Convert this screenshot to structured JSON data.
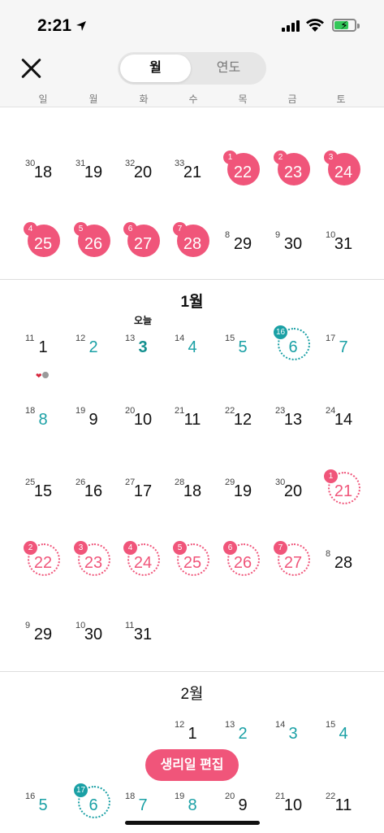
{
  "status": {
    "time": "2:21"
  },
  "header": {
    "tab_month": "월",
    "tab_year": "연도"
  },
  "weekdays": [
    "일",
    "월",
    "화",
    "수",
    "목",
    "금",
    "토"
  ],
  "colors": {
    "period": "#f0557a",
    "fertile": "#1aa0a5"
  },
  "today_label": "오늘",
  "months": {
    "dec_rows": [
      [
        {
          "d": "18",
          "s": "30"
        },
        {
          "d": "19",
          "s": "31"
        },
        {
          "d": "20",
          "s": "32"
        },
        {
          "d": "21",
          "s": "33"
        },
        {
          "d": "22",
          "b": "1",
          "t": "pink"
        },
        {
          "d": "23",
          "b": "2",
          "t": "pink"
        },
        {
          "d": "24",
          "b": "3",
          "t": "pink"
        }
      ],
      [
        {
          "d": "25",
          "b": "4",
          "t": "pink"
        },
        {
          "d": "26",
          "b": "5",
          "t": "pink"
        },
        {
          "d": "27",
          "b": "6",
          "t": "pink"
        },
        {
          "d": "28",
          "b": "7",
          "t": "pink"
        },
        {
          "d": "29",
          "s": "8"
        },
        {
          "d": "30",
          "s": "9"
        },
        {
          "d": "31",
          "s": "10"
        }
      ]
    ],
    "jan_title": "1월",
    "jan_rows": [
      [
        {
          "d": "1",
          "s": "11"
        },
        {
          "d": "2",
          "s": "12",
          "t": "teal"
        },
        {
          "d": "3",
          "s": "13",
          "t": "bold"
        },
        {
          "d": "4",
          "s": "14",
          "t": "teal"
        },
        {
          "d": "5",
          "s": "15",
          "t": "teal"
        },
        {
          "d": "6",
          "b": "16",
          "t": "dteal"
        },
        {
          "d": "7",
          "s": "17",
          "t": "teal"
        }
      ],
      [
        {
          "d": "8",
          "s": "18",
          "t": "teal"
        },
        {
          "d": "9",
          "s": "19"
        },
        {
          "d": "10",
          "s": "20"
        },
        {
          "d": "11",
          "s": "21"
        },
        {
          "d": "12",
          "s": "22"
        },
        {
          "d": "13",
          "s": "23"
        },
        {
          "d": "14",
          "s": "24"
        }
      ],
      [
        {
          "d": "15",
          "s": "25"
        },
        {
          "d": "16",
          "s": "26"
        },
        {
          "d": "17",
          "s": "27"
        },
        {
          "d": "18",
          "s": "28"
        },
        {
          "d": "19",
          "s": "29"
        },
        {
          "d": "20",
          "s": "30"
        },
        {
          "d": "21",
          "b": "1",
          "t": "dpink"
        }
      ],
      [
        {
          "d": "22",
          "b": "2",
          "t": "dpink"
        },
        {
          "d": "23",
          "b": "3",
          "t": "dpink"
        },
        {
          "d": "24",
          "b": "4",
          "t": "dpink"
        },
        {
          "d": "25",
          "b": "5",
          "t": "dpink"
        },
        {
          "d": "26",
          "b": "6",
          "t": "dpink"
        },
        {
          "d": "27",
          "b": "7",
          "t": "dpink"
        },
        {
          "d": "28",
          "s": "8"
        }
      ],
      [
        {
          "d": "29",
          "s": "9"
        },
        {
          "d": "30",
          "s": "10"
        },
        {
          "d": "31",
          "s": "11"
        }
      ]
    ],
    "feb_title": "2월",
    "feb_rows": [
      [
        null,
        null,
        null,
        {
          "d": "1",
          "s": "12"
        },
        {
          "d": "2",
          "s": "13",
          "t": "teal"
        },
        {
          "d": "3",
          "s": "14",
          "t": "teal"
        },
        {
          "d": "4",
          "s": "15",
          "t": "teal"
        }
      ],
      [
        {
          "d": "5",
          "s": "16",
          "t": "teal"
        },
        {
          "d": "6",
          "b": "17",
          "t": "dteal"
        },
        {
          "d": "7",
          "s": "18",
          "t": "teal"
        },
        {
          "d": "8",
          "s": "19",
          "t": "teal"
        },
        {
          "d": "9",
          "s": "20"
        },
        {
          "d": "10",
          "s": "21"
        },
        {
          "d": "11",
          "s": "22"
        }
      ]
    ]
  },
  "edit_button": "생리일 편집"
}
